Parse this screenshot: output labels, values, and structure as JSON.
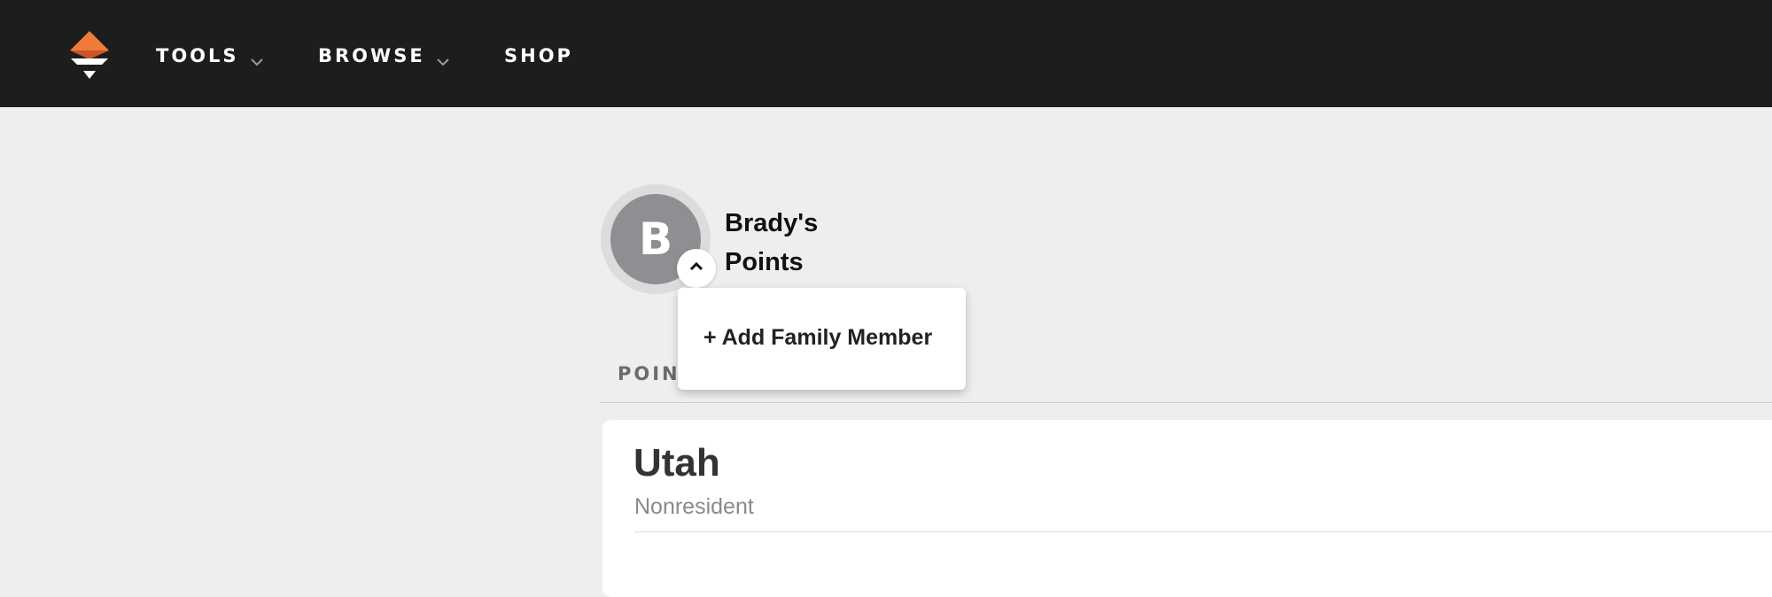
{
  "nav": {
    "logo": "brand-logo",
    "items": [
      {
        "label": "TOOLS",
        "has_dropdown": true
      },
      {
        "label": "BROWSE",
        "has_dropdown": true
      },
      {
        "label": "SHOP",
        "has_dropdown": false
      }
    ]
  },
  "profile": {
    "initial": "B",
    "name_line1": "Brady's",
    "name_line2": "Points",
    "toggle_icon": "chevron-up-icon"
  },
  "dropdown": {
    "items": [
      {
        "label": "+ Add Family Member"
      }
    ]
  },
  "tabs": {
    "visible_label": "POINT"
  },
  "card": {
    "state": "Utah",
    "residency": "Nonresident"
  },
  "colors": {
    "nav_bg": "#1d1d1d",
    "page_bg": "#eeeeee",
    "logo_orange": "#ee7b3a",
    "avatar_bg": "#8f8f93"
  }
}
